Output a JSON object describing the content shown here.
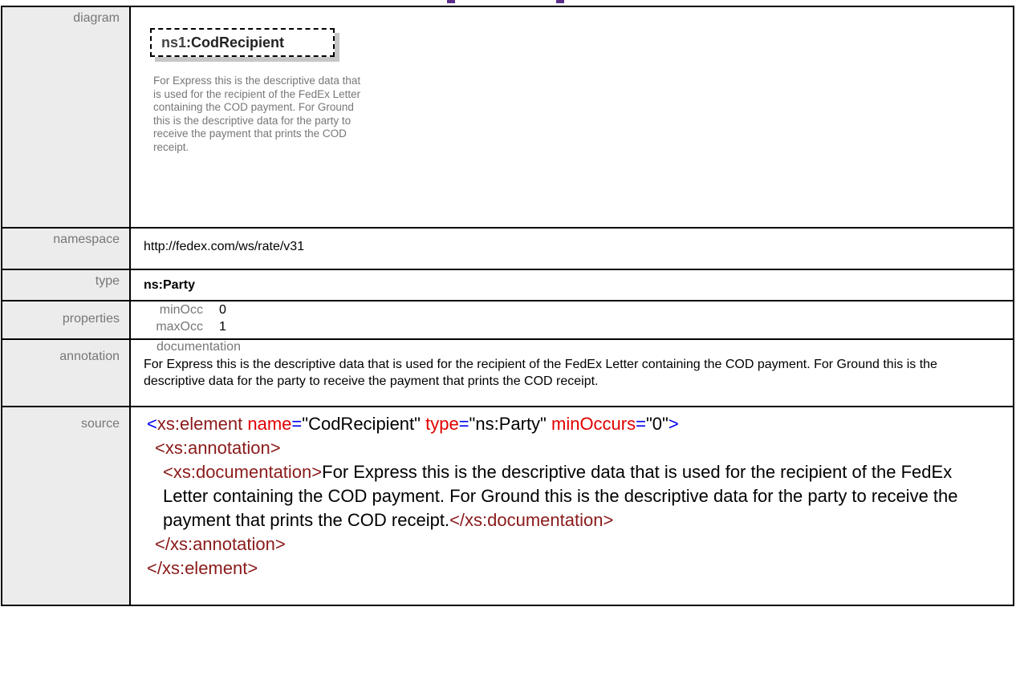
{
  "labels": {
    "diagram": "diagram",
    "namespace": "namespace",
    "type": "type",
    "properties": "properties",
    "annotation": "annotation",
    "source": "source"
  },
  "diagram": {
    "prefix": "ns1",
    "element_name": "CodRecipient",
    "documentation": "For Express this is the descriptive data that is used for the recipient of the FedEx Letter containing the COD payment. For Ground this is the descriptive data for the party to receive the payment that prints the COD receipt."
  },
  "namespace_value": "http://fedex.com/ws/rate/v31",
  "type_value": "ns:Party",
  "properties": [
    {
      "name": "minOcc",
      "value": "0"
    },
    {
      "name": "maxOcc",
      "value": "1"
    }
  ],
  "annotation": {
    "heading": "documentation",
    "text": "For Express this is the descriptive data that is used for the recipient of the FedEx Letter containing the COD payment. For Ground this is the descriptive data for the party to receive the payment that prints the COD receipt."
  },
  "source": {
    "line1": {
      "open": "<xs:element ",
      "attr1": "name",
      "val1": "\"CodRecipient\"",
      "attr2": "type",
      "val2": "\"ns:Party\"",
      "attr3": "minOccurs",
      "val3": "\"0\"",
      "close": ">"
    },
    "annotation_open": "<xs:annotation>",
    "documentation_open": "<xs:documentation>",
    "documentation_text": "For Express this is the descriptive data that is used for the recipient of the FedEx Letter containing the COD payment. For Ground this is the descriptive data for the party to receive the payment that prints the COD receipt.",
    "documentation_close": "</xs:documentation>",
    "annotation_close": "</xs:annotation>",
    "element_close": "</xs:element>"
  },
  "colors": {
    "tag": "#8b1a1a",
    "bracket": "#0000ee",
    "attribute": "#e00000",
    "label_bg": "#ececec",
    "heading_accent": "#5b2d8a"
  }
}
